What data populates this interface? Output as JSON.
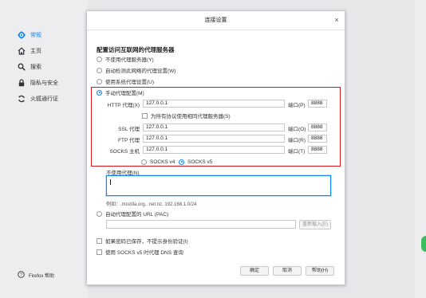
{
  "sidebar": {
    "items": [
      {
        "label": "常规",
        "icon": "gear-icon"
      },
      {
        "label": "主页",
        "icon": "home-icon"
      },
      {
        "label": "搜索",
        "icon": "search-icon"
      },
      {
        "label": "隐私与安全",
        "icon": "lock-icon"
      },
      {
        "label": "火狐通行证",
        "icon": "sync-icon"
      }
    ],
    "help_label": "Firefox 帮助"
  },
  "dialog": {
    "title": "连接设置",
    "close_glyph": "×",
    "heading": "配置访问互联网的代理服务器",
    "options": {
      "no_proxy": "不使用代理服务器(Y)",
      "auto_detect": "自动检测此网络的代理设置(W)",
      "system": "使用系统代理设置(U)",
      "manual": "手动代理配置(M)"
    },
    "manual": {
      "http_label": "HTTP 代理(X)",
      "http_value": "127.0.0.1",
      "http_port_label": "端口(P)",
      "http_port": "8888",
      "share_label": "为所有协议使用相同代理服务器(S)",
      "ssl_label": "SSL 代理",
      "ssl_value": "127.0.0.1",
      "ssl_port_label": "端口(O)",
      "ssl_port": "8888",
      "ftp_label": "FTP 代理",
      "ftp_value": "127.0.0.1",
      "ftp_port_label": "端口(R)",
      "ftp_port": "8888",
      "socks_label": "SOCKS 主机",
      "socks_value": "127.0.0.1",
      "socks_port_label": "端口(T)",
      "socks_port": "8888",
      "socks_v4": "SOCKS v4",
      "socks_v5": "SOCKS v5"
    },
    "no_proxy_for_label": "不使用代理(N)",
    "no_proxy_for_value": "",
    "example": "例如：.mozilla.org, .net.nz, 192.168.1.0/24",
    "pac_label": "自动代理配置的 URL (PAC)",
    "pac_value": "",
    "reload_label": "重新载入(E)",
    "no_prompt_auth": "如果密码已保存，不提示身份验证(I)",
    "socks_dns": "使用 SOCKS v5 时代理 DNS 查询",
    "buttons": {
      "ok": "确定",
      "cancel": "取消",
      "help": "帮助(H)"
    }
  },
  "colors": {
    "accent": "#0a84ff",
    "highlight_box": "#d9161e"
  }
}
